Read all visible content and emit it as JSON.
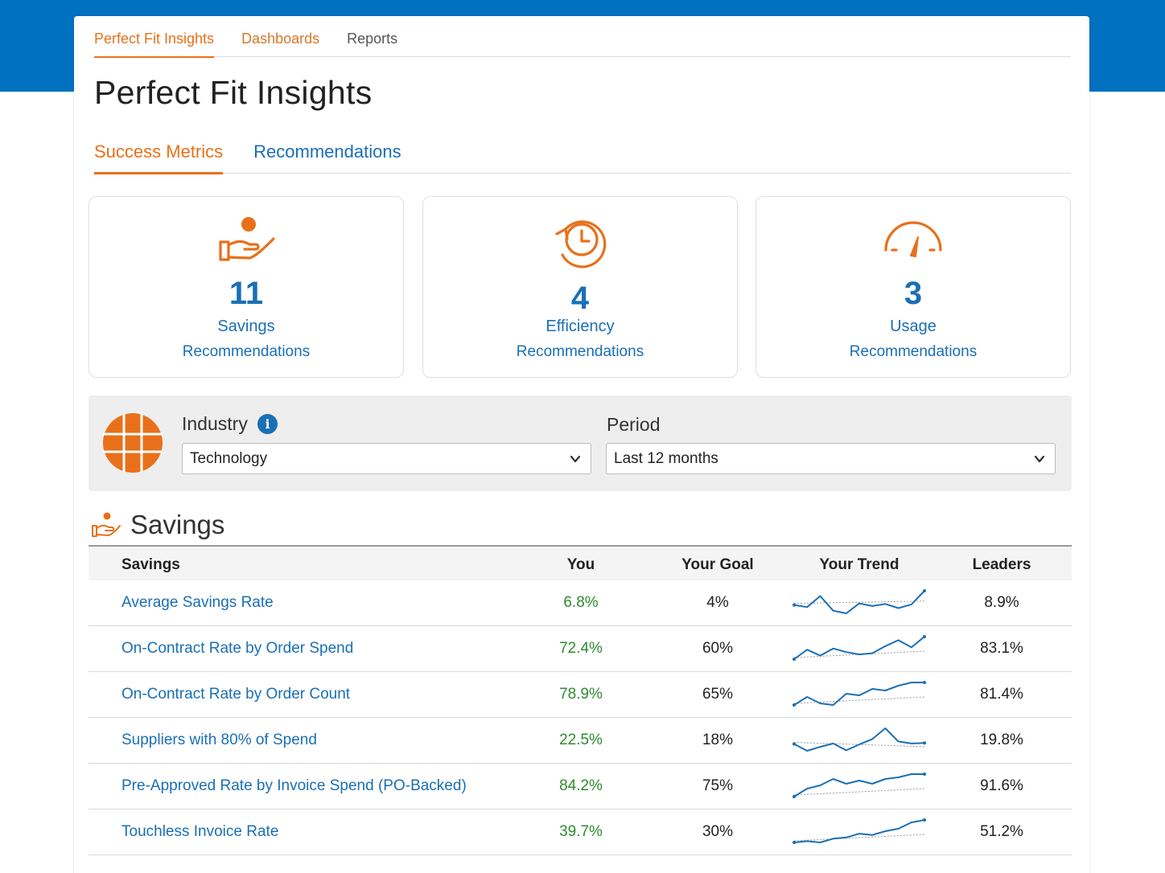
{
  "topnav": {
    "items": [
      {
        "label": "Perfect Fit Insights",
        "active": true
      },
      {
        "label": "Dashboards",
        "active": false
      },
      {
        "label": "Reports",
        "active": false
      }
    ]
  },
  "page_title": "Perfect Fit Insights",
  "subtabs": [
    {
      "label": "Success Metrics",
      "active": true
    },
    {
      "label": "Recommendations",
      "active": false
    }
  ],
  "metrics": [
    {
      "icon": "hand-coin-icon",
      "value": "11",
      "line1": "Savings",
      "line2": "Recommendations"
    },
    {
      "icon": "clock-history-icon",
      "value": "4",
      "line1": "Efficiency",
      "line2": "Recommendations"
    },
    {
      "icon": "gauge-icon",
      "value": "3",
      "line1": "Usage",
      "line2": "Recommendations"
    }
  ],
  "filters": {
    "industry_label": "Industry",
    "industry_value": "Technology",
    "period_label": "Period",
    "period_value": "Last 12 months"
  },
  "section": {
    "title": "Savings",
    "columns": [
      "Savings",
      "You",
      "Your Goal",
      "Your Trend",
      "Leaders"
    ],
    "rows": [
      {
        "name": "Average Savings Rate",
        "you": "6.8%",
        "goal": "4%",
        "leaders": "8.9%",
        "trend": [
          5.2,
          4.8,
          6.9,
          4.1,
          3.6,
          5.5,
          5.0,
          5.4,
          4.6,
          5.3,
          7.9
        ]
      },
      {
        "name": "On-Contract Rate by Order Spend",
        "you": "72.4%",
        "goal": "60%",
        "leaders": "83.1%",
        "trend": [
          61,
          69,
          64,
          70,
          67,
          65,
          66,
          72,
          77,
          71,
          80
        ]
      },
      {
        "name": "On-Contract Rate by Order Count",
        "you": "78.9%",
        "goal": "65%",
        "leaders": "81.4%",
        "trend": [
          66,
          71,
          67,
          66,
          73,
          72,
          76,
          75,
          78,
          80,
          80
        ]
      },
      {
        "name": "Suppliers with 80% of Spend",
        "you": "22.5%",
        "goal": "18%",
        "leaders": "19.8%",
        "trend": [
          20,
          18.6,
          19.4,
          20.1,
          18.7,
          19.9,
          21,
          23.2,
          20.5,
          20.1,
          20.2
        ]
      },
      {
        "name": "Pre-Approved Rate by Invoice Spend (PO-Backed)",
        "you": "84.2%",
        "goal": "75%",
        "leaders": "91.6%",
        "trend": [
          70,
          75,
          77,
          81,
          78,
          80,
          78,
          81,
          82,
          84,
          84
        ]
      },
      {
        "name": "Touchless Invoice Rate",
        "you": "39.7%",
        "goal": "30%",
        "leaders": "51.2%",
        "trend": [
          25,
          26,
          25,
          28,
          29,
          32,
          31,
          34,
          36,
          41,
          43
        ]
      }
    ]
  },
  "colors": {
    "brand_blue": "#0070c0",
    "accent_orange": "#e8701a",
    "link_blue": "#1a6fb5",
    "positive_green": "#2e8b2e"
  }
}
